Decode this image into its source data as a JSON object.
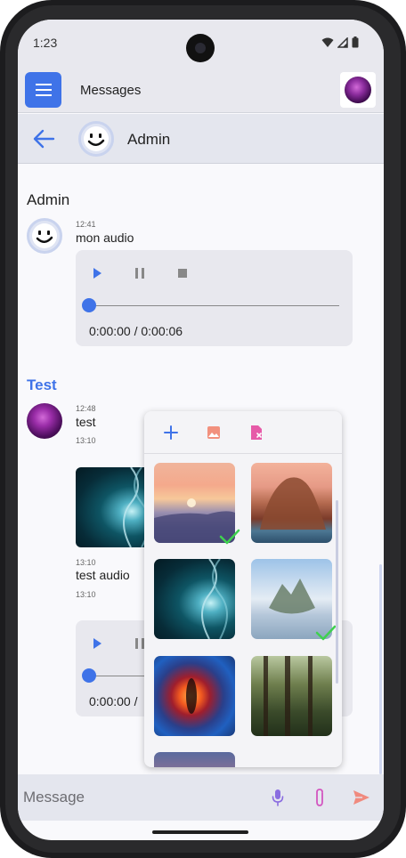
{
  "status_bar": {
    "time": "1:23"
  },
  "app_bar": {
    "title": "Messages"
  },
  "conversation": {
    "name": "Admin"
  },
  "messages": [
    {
      "sender": "Admin",
      "time": "12:41",
      "text": "mon audio",
      "audio": {
        "duration": "0:00:00 / 0:00:06"
      }
    },
    {
      "sender": "Test",
      "time": "12:48",
      "text": "test",
      "time_after": "13:10",
      "image_time": "13:10",
      "text2": "test audio",
      "time2": "13:10",
      "audio": {
        "duration": "0:00:00 / "
      }
    }
  ],
  "composer": {
    "placeholder": "Message"
  },
  "colors": {
    "accent": "#3f73e8",
    "test_sender": "#3f73e8",
    "mic": "#8a6de0",
    "attach": "#d356c0",
    "send": "#f08a7e",
    "check": "#3fd14f"
  },
  "picker": {
    "actions": [
      "plus-icon",
      "image-icon",
      "file-remove-icon"
    ],
    "images": [
      {
        "name": "sunset",
        "selected": true
      },
      {
        "name": "rock-arch",
        "selected": false
      },
      {
        "name": "dna",
        "selected": false
      },
      {
        "name": "floating-island",
        "selected": true
      },
      {
        "name": "dragon-eye",
        "selected": false
      },
      {
        "name": "forest",
        "selected": false
      },
      {
        "name": "sky-partial",
        "selected": false
      }
    ]
  }
}
